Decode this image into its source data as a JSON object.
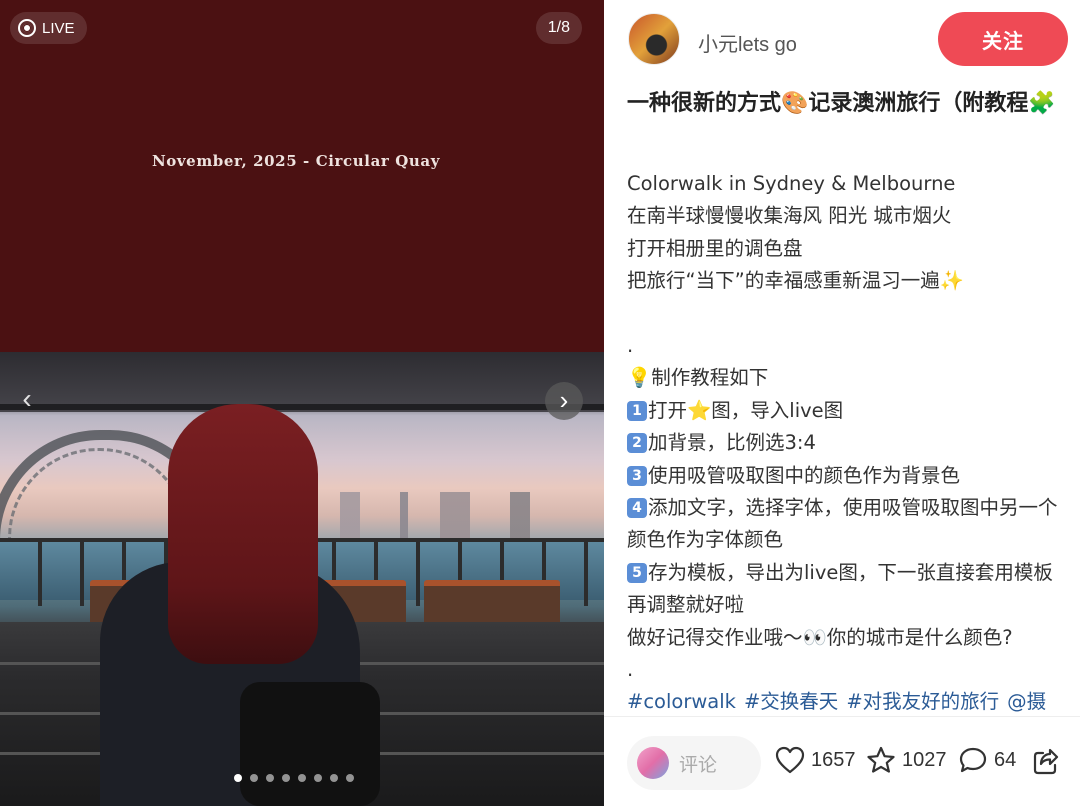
{
  "media": {
    "live_label": "LIVE",
    "page_counter": "1/8",
    "caption": "November, 2025 - Circular Quay",
    "prev_icon": "chevron-left-icon",
    "next_icon": "chevron-right-icon",
    "slide_count": 8,
    "active_slide": 1,
    "background_color": "#4b1112"
  },
  "author": {
    "name": "小元lets go",
    "follow_label": "关注",
    "follow_color": "#ef4a55"
  },
  "note": {
    "title": "一种很新的方式🎨记录澳洲旅行（附教程🧩",
    "lines": [
      "Colorwalk in Sydney & Melbourne",
      "在南半球慢慢收集海风 阳光 城市烟火",
      "打开相册里的调色盘",
      "把旅行“当下”的幸福感重新温习一遍✨",
      "",
      ".",
      "💡制作教程如下"
    ],
    "steps": [
      {
        "num": "1",
        "text": "打开⭐图，导入live图"
      },
      {
        "num": "2",
        "text": "加背景，比例选3:4"
      },
      {
        "num": "3",
        "text": "使用吸管吸取图中的颜色作为背景色"
      },
      {
        "num": "4",
        "text": "添加文字，选择字体，使用吸管吸取图中另一个颜色作为字体颜色"
      },
      {
        "num": "5",
        "text": "存为模板，导出为live图，下一张直接套用模板再调整就好啦"
      }
    ],
    "closing": "做好记得交作业哦～👀你的城市是什么颜色?",
    "closing_dot": ".",
    "tags": [
      "#colorwalk",
      "#交换春天",
      "#对我友好的旅行",
      "@摄"
    ]
  },
  "bottom_bar": {
    "comment_placeholder": "评论",
    "likes": "1657",
    "favorites": "1027",
    "comments": "64",
    "like_icon": "heart-icon",
    "favorite_icon": "star-icon",
    "comment_icon": "comment-bubble-icon",
    "share_icon": "share-icon"
  }
}
